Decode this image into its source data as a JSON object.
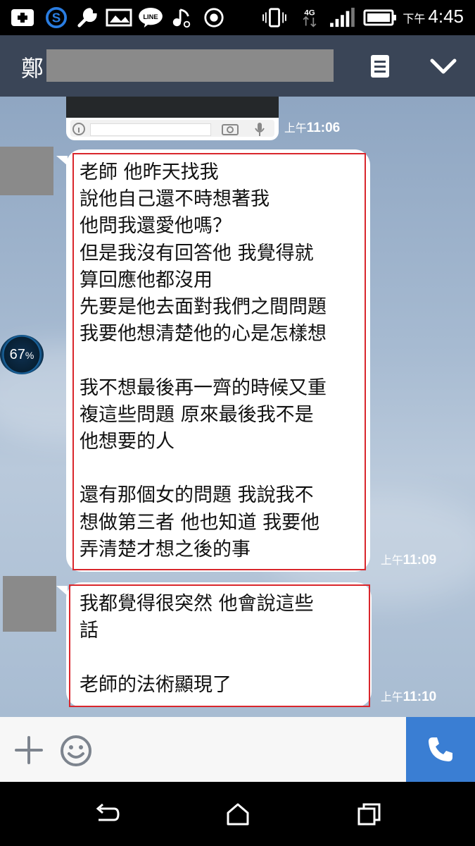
{
  "status_bar": {
    "time_prefix": "下午",
    "time": "4:45",
    "network": "4G",
    "icons": [
      "add-icon",
      "skype-icon",
      "wrench-icon",
      "image-icon",
      "line-icon",
      "music-icon",
      "record-icon",
      "vibrate-icon",
      "network-4g-icon",
      "signal-icon",
      "battery-icon"
    ]
  },
  "header": {
    "contact_name": "鄭",
    "menu_icon": "notes-icon",
    "collapse_icon": "chevron-down-icon"
  },
  "messages": [
    {
      "type": "image",
      "time_prefix": "上午",
      "time": "11:06"
    },
    {
      "type": "text",
      "time_prefix": "上午",
      "time": "11:09",
      "text": "老師 他昨天找我\n說他自己還不時想著我\n他問我還愛他嗎？\n但是我沒有回答他 我覺得就\n算回應他都沒用\n先要是他去面對我們之間問題\n我要他想清楚他的心是怎樣想\n\n我不想最後再一齊的時候又重\n複這些問題 原來最後我不是\n他想要的人\n\n還有那個女的問題 我說我不\n想做第三者 他也知道 我要他\n弄清楚才想之後的事"
    },
    {
      "type": "text",
      "time_prefix": "上午",
      "time": "11:10",
      "text": "我都覺得很突然 他會說這些\n話\n\n老師的法術顯現了"
    }
  ],
  "overlay_badge": {
    "value": "67",
    "unit": "%"
  },
  "colors": {
    "header": "#3a4557",
    "highlight": "#d9262c",
    "call": "#3a7ed3"
  }
}
